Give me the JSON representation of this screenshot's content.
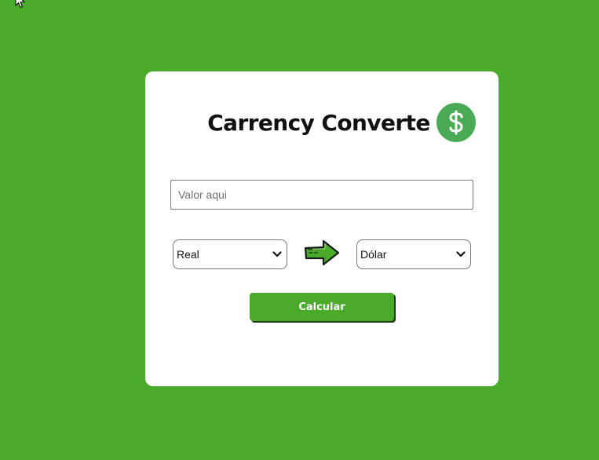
{
  "app": {
    "title": "Carrency Converte",
    "title_icon": "dollar-icon"
  },
  "form": {
    "value_placeholder": "Valor aqui",
    "value": "",
    "from_currency": "Real",
    "to_currency": "Dólar",
    "swap_icon": "arrow-right-icon",
    "submit_label": "Calcular"
  },
  "colors": {
    "background": "#4aaa2a",
    "card": "#ffffff",
    "accent": "#4aaa55",
    "button": "#4aaa2a"
  }
}
